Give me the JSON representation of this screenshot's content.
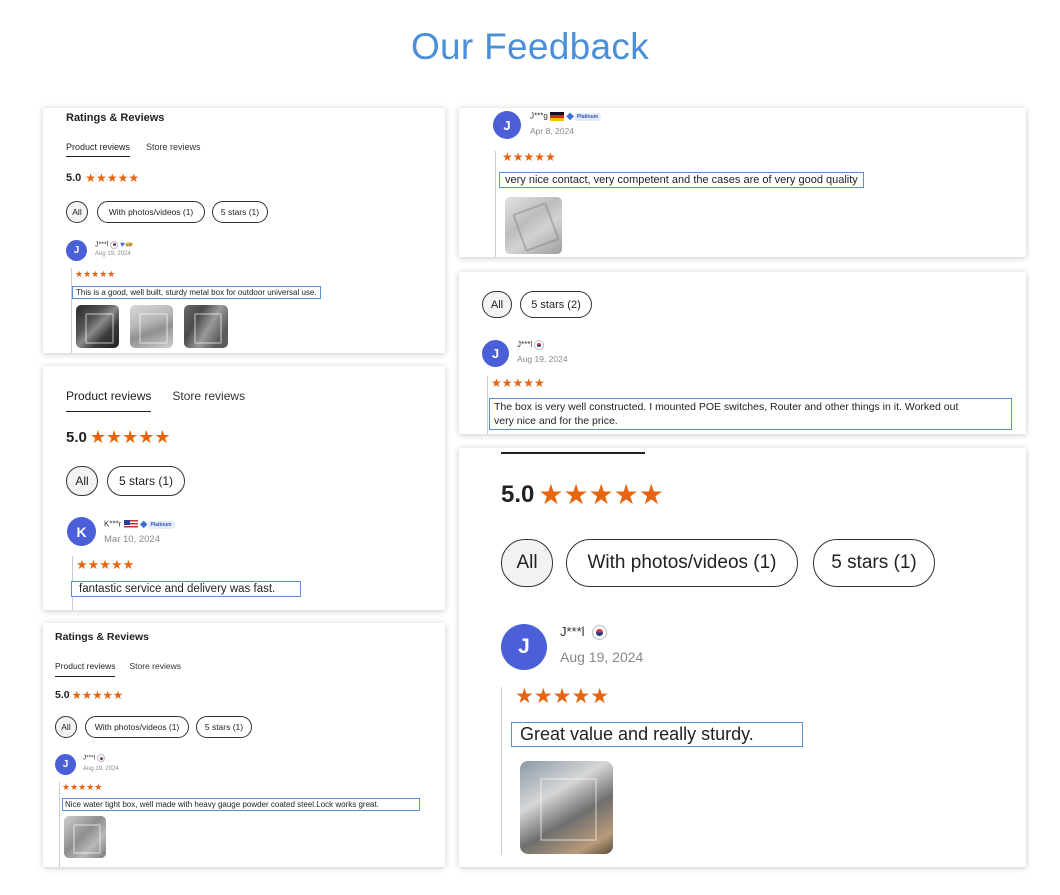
{
  "page": {
    "title": "Our Feedback"
  },
  "colors": {
    "title": "#4a8fd8",
    "star": "#e8640f",
    "avatar": "#4a5fd8",
    "text_box_border": "#5a8fcf"
  },
  "card1": {
    "heading": "Ratings & Reviews",
    "tabs": [
      "Product reviews",
      "Store reviews"
    ],
    "rating": "5.0",
    "stars": "★★★★★",
    "chips": [
      "All",
      "With photos/videos (1)",
      "5 stars (1)"
    ],
    "review": {
      "avatar": "J",
      "user": "J***l",
      "flag": "kr-flag-icon",
      "badge": "VIP",
      "date": "Aug 19, 2024",
      "stars": "★★★★★",
      "text": "This is a good, well built, sturdy metal box for outdoor universal use."
    }
  },
  "card2": {
    "review": {
      "avatar": "J",
      "user": "J***g",
      "flag": "de-flag-icon",
      "badge": "Platinum",
      "date": "Apr 8, 2024",
      "stars": "★★★★★",
      "text": "very nice contact, very competent and the cases are of very good quality"
    }
  },
  "card3": {
    "chips": [
      "All",
      "5 stars (2)"
    ],
    "review": {
      "avatar": "J",
      "user": "J***l",
      "flag": "kr-flag-icon",
      "date": "Aug 19, 2024",
      "stars": "★★★★★",
      "text_line1": "The box is very well constructed. I mounted POE switches, Router and other things in it. Worked out",
      "text_line2": "very nice and for the price."
    }
  },
  "card4": {
    "tabs": [
      "Product reviews",
      "Store reviews"
    ],
    "rating": "5.0",
    "stars": "★★★★★",
    "chips": [
      "All",
      "5 stars (1)"
    ],
    "review": {
      "avatar": "K",
      "user": "K***r",
      "flag": "us-flag-icon",
      "badge": "Platinum",
      "date": "Mar 10, 2024",
      "stars": "★★★★★",
      "text": "fantastic service and delivery was fast."
    }
  },
  "card5": {
    "rating": "5.0",
    "stars": "★★★★★",
    "chips": [
      "All",
      "With photos/videos (1)",
      "5 stars (1)"
    ],
    "review": {
      "avatar": "J",
      "user": "J***l",
      "flag": "kr-flag-icon",
      "date": "Aug 19, 2024",
      "stars": "★★★★★",
      "text": "Great value and really sturdy."
    }
  },
  "card6": {
    "heading": "Ratings & Reviews",
    "tabs": [
      "Product reviews",
      "Store reviews"
    ],
    "rating": "5.0",
    "stars": "★★★★★",
    "chips": [
      "All",
      "With photos/videos (1)",
      "5 stars (1)"
    ],
    "review": {
      "avatar": "J",
      "user": "J***l",
      "flag": "kr-flag-icon",
      "date": "Aug 19, 2024",
      "stars": "★★★★★",
      "text": "Nice water tight box, well made with heavy gauge powder coated steel.Lock works great."
    }
  }
}
